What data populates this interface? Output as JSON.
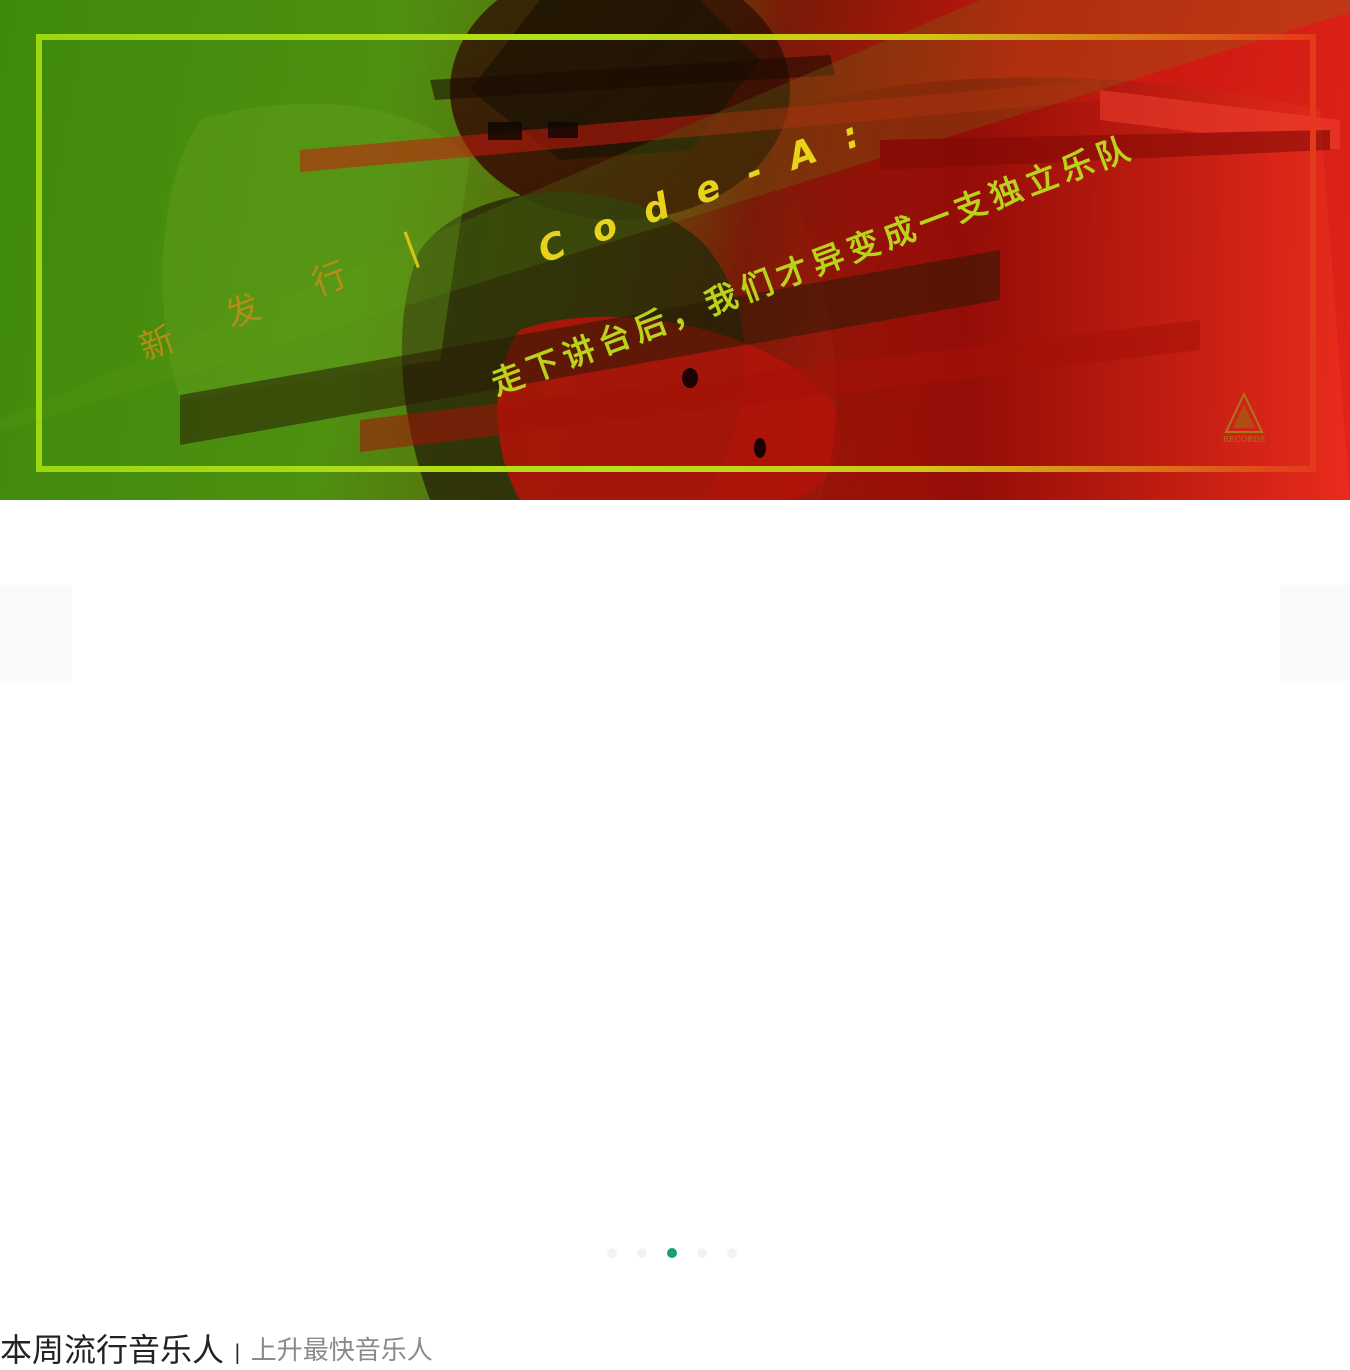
{
  "banner": {
    "tag_chars": [
      "新",
      "发",
      "行"
    ],
    "tag_separator": "|",
    "title": "Code-A:",
    "subtitle": "走下讲台后，我们才异变成一支独立乐队",
    "logo_text": "RECORDS",
    "colors": {
      "frame": "#a6dc12",
      "green_bg": "#3f8a0b",
      "red_bg": "#e0241a",
      "title": "#e7d31a"
    }
  },
  "carousel": {
    "slide_count": 5,
    "active_index": 2,
    "active_color": "#1a9e75",
    "inactive_color": "#f2f2f2"
  },
  "section": {
    "title": "本周流行音乐人",
    "separator": "|",
    "alt_title": "上升最快音乐人"
  }
}
